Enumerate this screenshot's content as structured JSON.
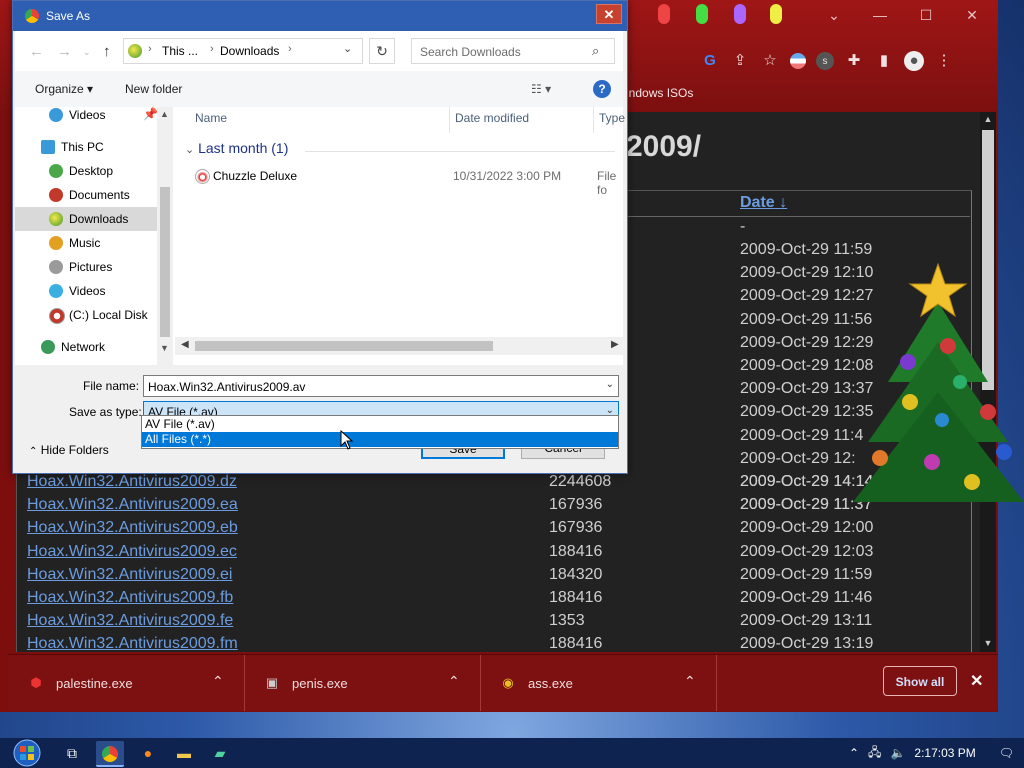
{
  "browser": {
    "bookmark": "indows ISOs",
    "page_heading": "2009/",
    "date_header": "Date",
    "sort_arrow": "↓",
    "date_first": "-",
    "upper_dates": [
      "2009-Oct-29 11:59",
      "2009-Oct-29 12:10",
      "2009-Oct-29 12:27",
      "2009-Oct-29 11:56",
      "2009-Oct-29 12:29",
      "2009-Oct-29 12:08",
      "2009-Oct-29 13:37",
      "2009-Oct-29 12:35",
      "2009-Oct-29 11:4",
      "2009-Oct-29 12:",
      "2009-Oct-29 14:14",
      "2009-Oct-29 11:37"
    ],
    "rows": [
      {
        "name": "Hoax.Win32.Antivirus2009.dz",
        "size": "2244608",
        "date": "2009-Oct-29 14:14"
      },
      {
        "name": "Hoax.Win32.Antivirus2009.ea",
        "size": "167936",
        "date": "2009-Oct-29 11:37"
      },
      {
        "name": "Hoax.Win32.Antivirus2009.eb",
        "size": "167936",
        "date": "2009-Oct-29 12:00"
      },
      {
        "name": "Hoax.Win32.Antivirus2009.ec",
        "size": "188416",
        "date": "2009-Oct-29 12:03"
      },
      {
        "name": "Hoax.Win32.Antivirus2009.ei",
        "size": "184320",
        "date": "2009-Oct-29 11:59"
      },
      {
        "name": "Hoax.Win32.Antivirus2009.fb",
        "size": "188416",
        "date": "2009-Oct-29 11:46"
      },
      {
        "name": "Hoax.Win32.Antivirus2009.fe",
        "size": "1353",
        "date": "2009-Oct-29 13:11"
      },
      {
        "name": "Hoax.Win32.Antivirus2009.fm",
        "size": "188416",
        "date": "2009-Oct-29 13:19"
      }
    ]
  },
  "downloads": {
    "items": [
      {
        "name": "palestine.exe",
        "icon": "shield-icon"
      },
      {
        "name": "penis.exe",
        "icon": "installer-icon"
      },
      {
        "name": "ass.exe",
        "icon": "disc-icon"
      }
    ],
    "show_all": "Show all",
    "close": "✕"
  },
  "taskbar": {
    "time": "2:17:03 PM"
  },
  "dialog": {
    "title": "Save As",
    "close": "✕",
    "address": [
      "This ...",
      "Downloads"
    ],
    "search_placeholder": "Search Downloads",
    "organize": "Organize ▾",
    "new_folder": "New folder",
    "help": "?",
    "nav_items": [
      {
        "label": "Videos",
        "color": "#3a9ad9"
      },
      {
        "label": "This PC",
        "color": "#3a9ad9"
      },
      {
        "label": "Desktop",
        "color": "#4aa84a"
      },
      {
        "label": "Documents",
        "color": "#c0392b"
      },
      {
        "label": "Downloads",
        "color": "#e0c020"
      },
      {
        "label": "Music",
        "color": "#e0a020"
      },
      {
        "label": "Pictures",
        "color": "#9a9a9a"
      },
      {
        "label": "Videos",
        "color": "#3ab0e0"
      },
      {
        "label": "(C:) Local Disk",
        "color": "#c0392b"
      },
      {
        "label": "Network",
        "color": "#3a9a5a"
      }
    ],
    "columns": {
      "name": "Name",
      "date": "Date modified",
      "type": "Type"
    },
    "group": "Last month (1)",
    "file": {
      "name": "Chuzzle Deluxe",
      "date": "10/31/2022 3:00 PM",
      "type": "File fo"
    },
    "file_name_label": "File name:",
    "file_name_value": "Hoax.Win32.Antivirus2009.av",
    "save_type_label": "Save as type:",
    "save_type_value": "AV File (*.av)",
    "options": [
      "AV File (*.av)",
      "All Files (*.*)"
    ],
    "hide_folders": "Hide Folders",
    "save": "Save",
    "cancel": "Cancel"
  }
}
